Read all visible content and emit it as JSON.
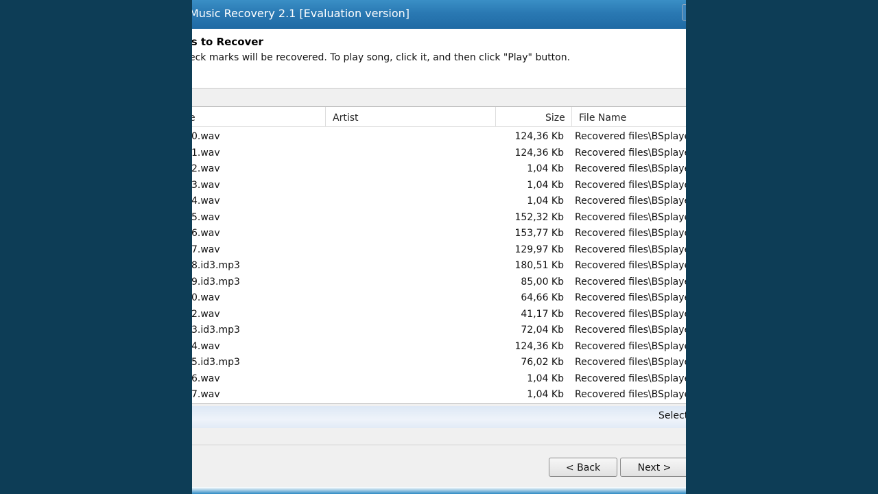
{
  "window": {
    "title": "Music Recovery 2.1 [Evaluation version]"
  },
  "header": {
    "title": "gs to Recover",
    "description": "eck marks will be recovered. To play song, click it, and then click \"Play\" button."
  },
  "list": {
    "columns": {
      "name": "e",
      "artist": "Artist",
      "size": "Size",
      "file": "File Name"
    },
    "rows": [
      {
        "name": "0.wav",
        "artist": "",
        "size": "124,36 Kb",
        "file": "Recovered files\\BSplaye"
      },
      {
        "name": "1.wav",
        "artist": "",
        "size": "124,36 Kb",
        "file": "Recovered files\\BSplaye"
      },
      {
        "name": "2.wav",
        "artist": "",
        "size": "1,04 Kb",
        "file": "Recovered files\\BSplaye"
      },
      {
        "name": "3.wav",
        "artist": "",
        "size": "1,04 Kb",
        "file": "Recovered files\\BSplaye"
      },
      {
        "name": "4.wav",
        "artist": "",
        "size": "1,04 Kb",
        "file": "Recovered files\\BSplaye"
      },
      {
        "name": "5.wav",
        "artist": "",
        "size": "152,32 Kb",
        "file": "Recovered files\\BSplaye"
      },
      {
        "name": "6.wav",
        "artist": "",
        "size": "153,77 Kb",
        "file": "Recovered files\\BSplaye"
      },
      {
        "name": "7.wav",
        "artist": "",
        "size": "129,97 Kb",
        "file": "Recovered files\\BSplaye"
      },
      {
        "name": "8.id3.mp3",
        "artist": "",
        "size": "180,51 Kb",
        "file": "Recovered files\\BSplaye"
      },
      {
        "name": "9.id3.mp3",
        "artist": "",
        "size": "85,00 Kb",
        "file": "Recovered files\\BSplaye"
      },
      {
        "name": "0.wav",
        "artist": "",
        "size": "64,66 Kb",
        "file": "Recovered files\\BSplaye"
      },
      {
        "name": "2.wav",
        "artist": "",
        "size": "41,17 Kb",
        "file": "Recovered files\\BSplaye"
      },
      {
        "name": "3.id3.mp3",
        "artist": "",
        "size": "72,04 Kb",
        "file": "Recovered files\\BSplaye"
      },
      {
        "name": "4.wav",
        "artist": "",
        "size": "124,36 Kb",
        "file": "Recovered files\\BSplaye"
      },
      {
        "name": "5.id3.mp3",
        "artist": "",
        "size": "76,02 Kb",
        "file": "Recovered files\\BSplaye"
      },
      {
        "name": "6.wav",
        "artist": "",
        "size": "1,04 Kb",
        "file": "Recovered files\\BSplaye"
      },
      {
        "name": "7.wav",
        "artist": "",
        "size": "1,04 Kb",
        "file": "Recovered files\\BSplaye"
      }
    ]
  },
  "status": {
    "text": "Select"
  },
  "buttons": {
    "back": "< Back",
    "next": "Next >"
  },
  "colors": {
    "background": "#0d3d56",
    "titlebar": "#2a79b3",
    "status_band": "#e2ebf6"
  }
}
